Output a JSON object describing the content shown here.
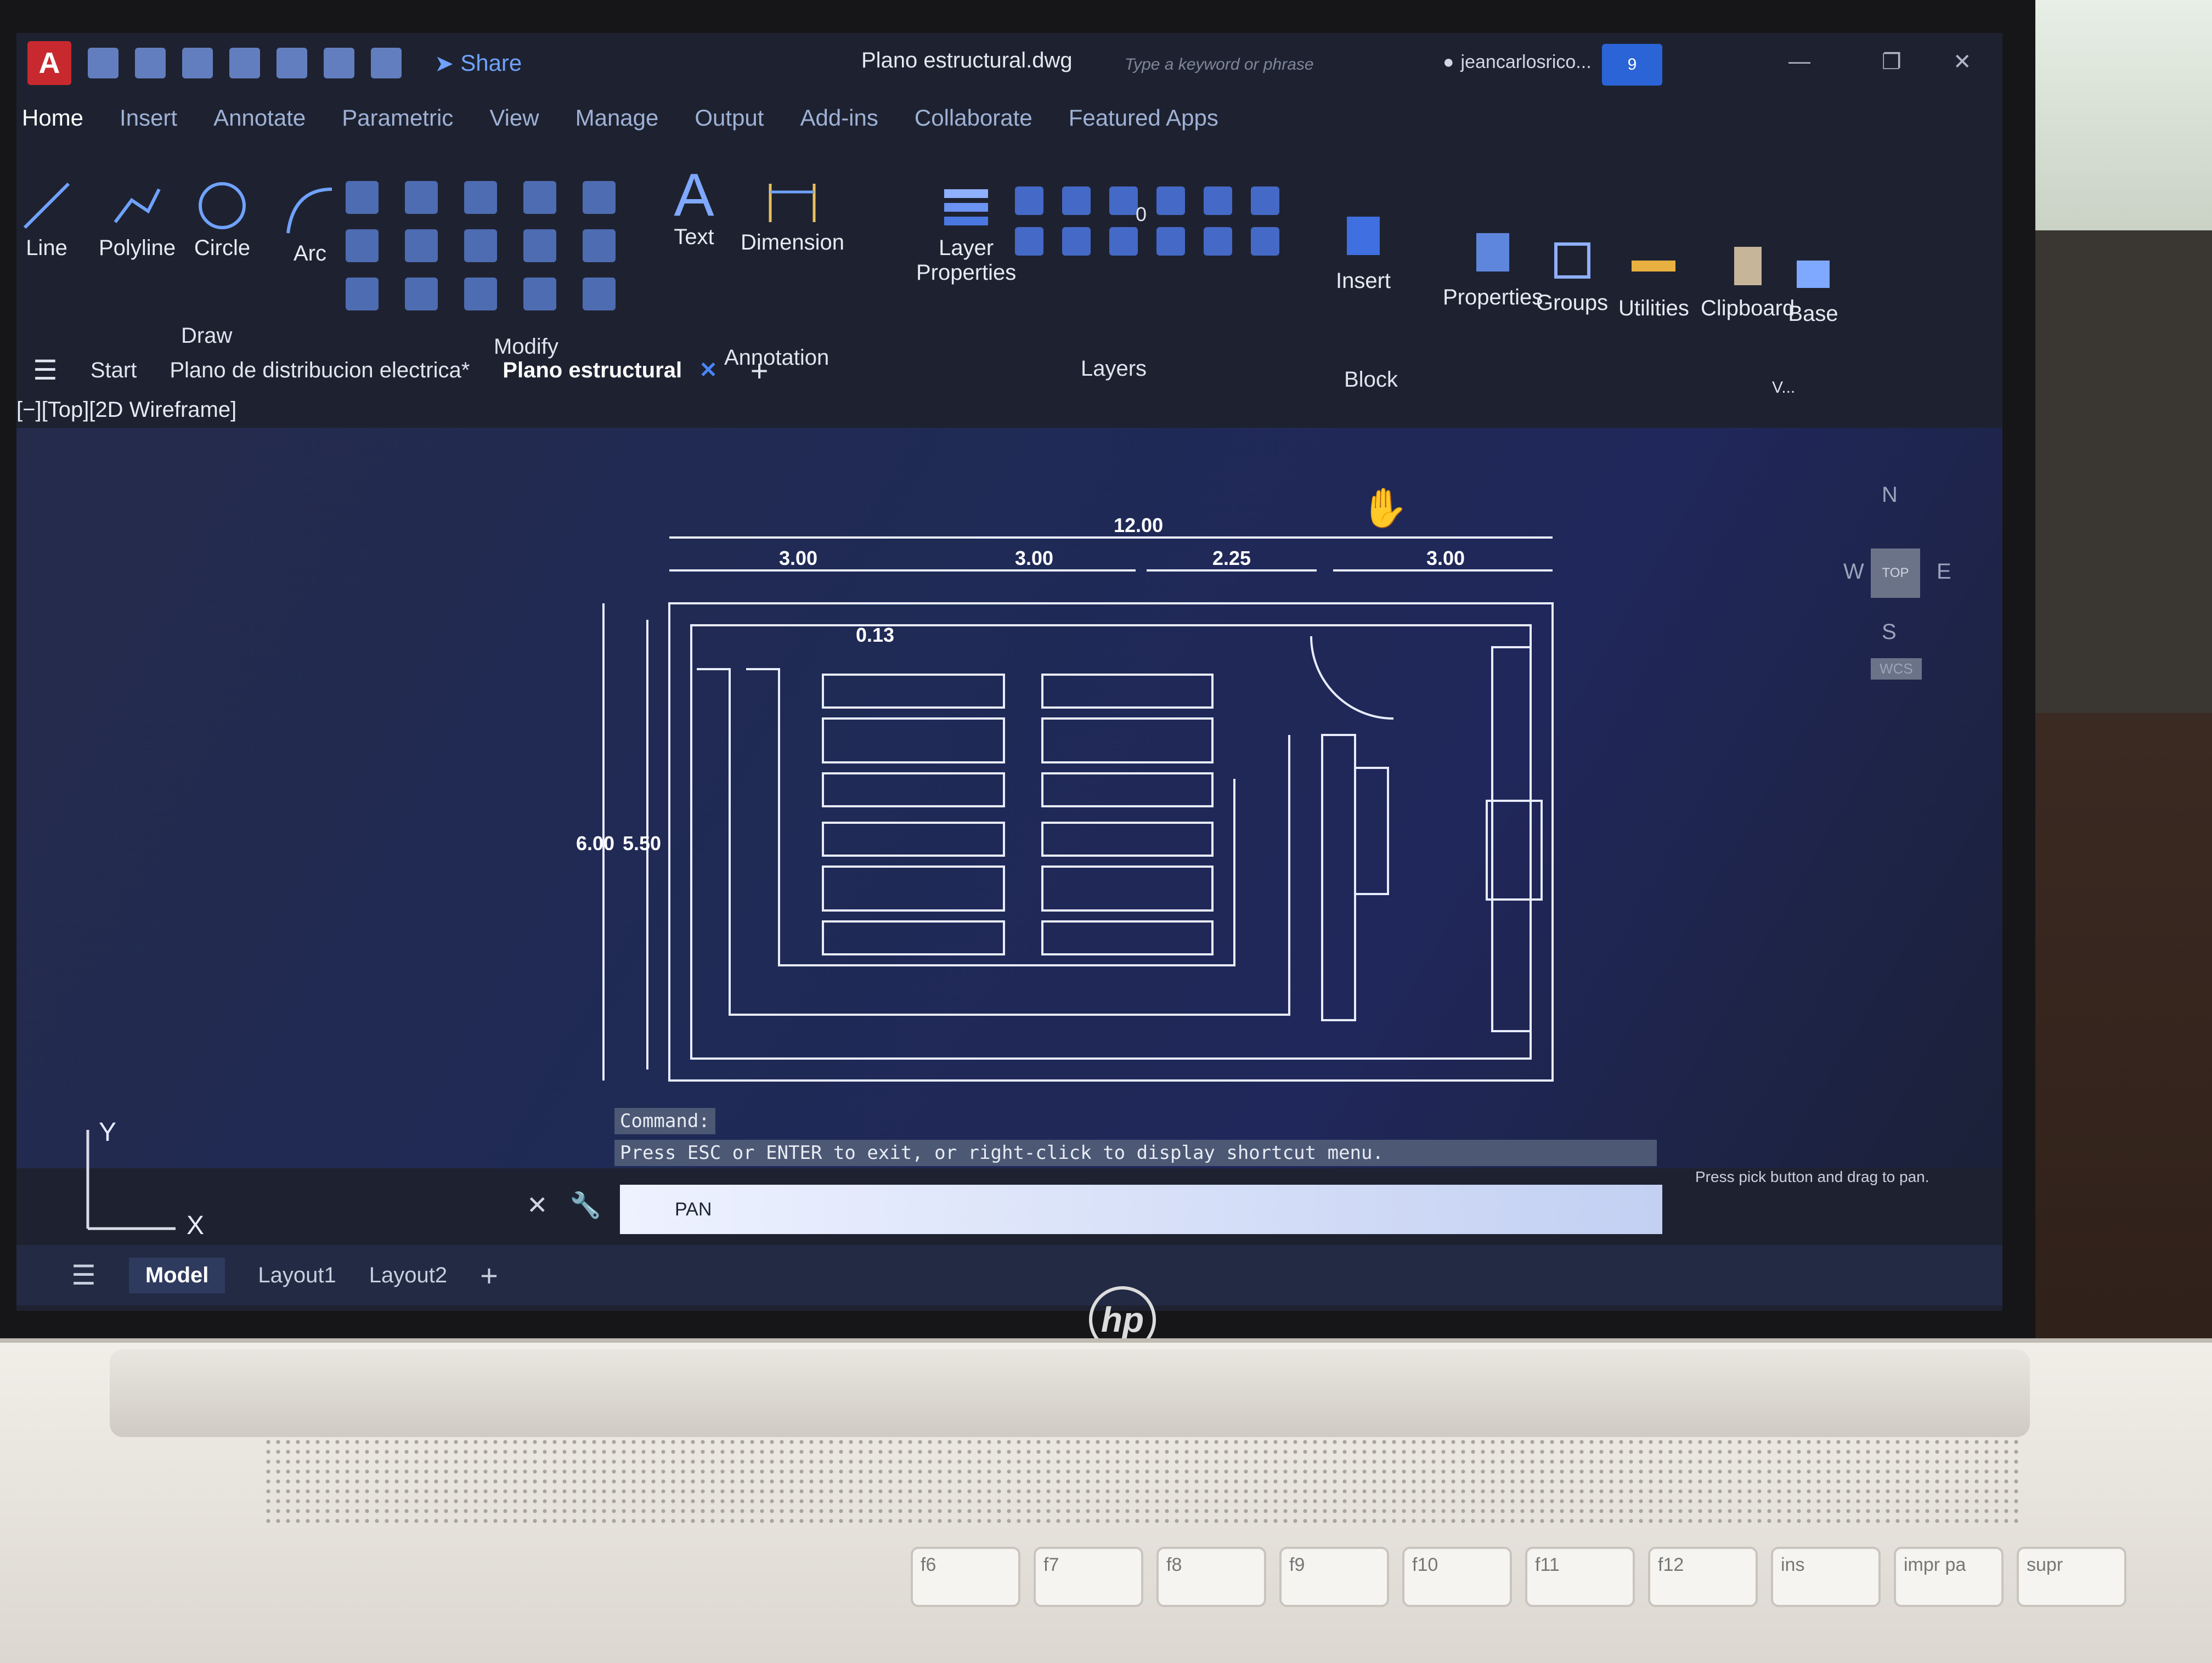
{
  "app": {
    "logo": "A",
    "document_title": "Plano estructural.dwg",
    "share_label": "Share",
    "search_placeholder": "Type a keyword or phrase",
    "user": "jeancarlosrico...",
    "notifications": "9"
  },
  "ribbon_tabs": [
    "Home",
    "Insert",
    "Annotate",
    "Parametric",
    "View",
    "Manage",
    "Output",
    "Add-ins",
    "Collaborate",
    "Featured Apps"
  ],
  "tools": {
    "line": "Line",
    "polyline": "Polyline",
    "circle": "Circle",
    "arc": "Arc",
    "text": "Text",
    "dimension": "Dimension",
    "layer_properties_1": "Layer",
    "layer_properties_2": "Properties",
    "insert": "Insert",
    "properties": "Properties",
    "groups": "Groups",
    "utilities": "Utilities",
    "clipboard": "Clipboard",
    "base": "Base",
    "layer_value": "0"
  },
  "panels": {
    "draw": "Draw",
    "modify": "Modify",
    "annotation": "Annotation",
    "layers": "Layers",
    "block": "Block",
    "view_short": "V..."
  },
  "doc_tabs": {
    "start": "Start",
    "tab1": "Plano de distribucion electrica*",
    "tab2": "Plano estructural"
  },
  "viewport_label": "[−][Top][2D Wireframe]",
  "dimensions": {
    "overall": "12.00",
    "seg1": "3.00",
    "seg2": "3.00",
    "seg3": "2.25",
    "seg4": "3.00",
    "small": "0.13",
    "height_outer": "6.00",
    "height_inner": "5.50"
  },
  "viewcube": {
    "n": "N",
    "s": "S",
    "e": "E",
    "w": "W",
    "top": "TOP",
    "wcs": "WCS"
  },
  "ucs": {
    "x": "X",
    "y": "Y"
  },
  "command": {
    "history_1": "Command:",
    "history_2": "Press ESC or ENTER to exit, or right-click to display shortcut menu.",
    "current": "PAN",
    "status": "Press pick button and drag to pan."
  },
  "layouts": [
    "Model",
    "Layout1",
    "Layout2"
  ],
  "keyboard": [
    "f6",
    "f7",
    "f8",
    "f9",
    "f10",
    "f11",
    "f12",
    "ins",
    "impr pa",
    "supr"
  ],
  "brand": "hp",
  "colors": {
    "accent": "#2a64d6",
    "app_logo": "#c8292f",
    "drawing_lines": "#e8ecff"
  }
}
